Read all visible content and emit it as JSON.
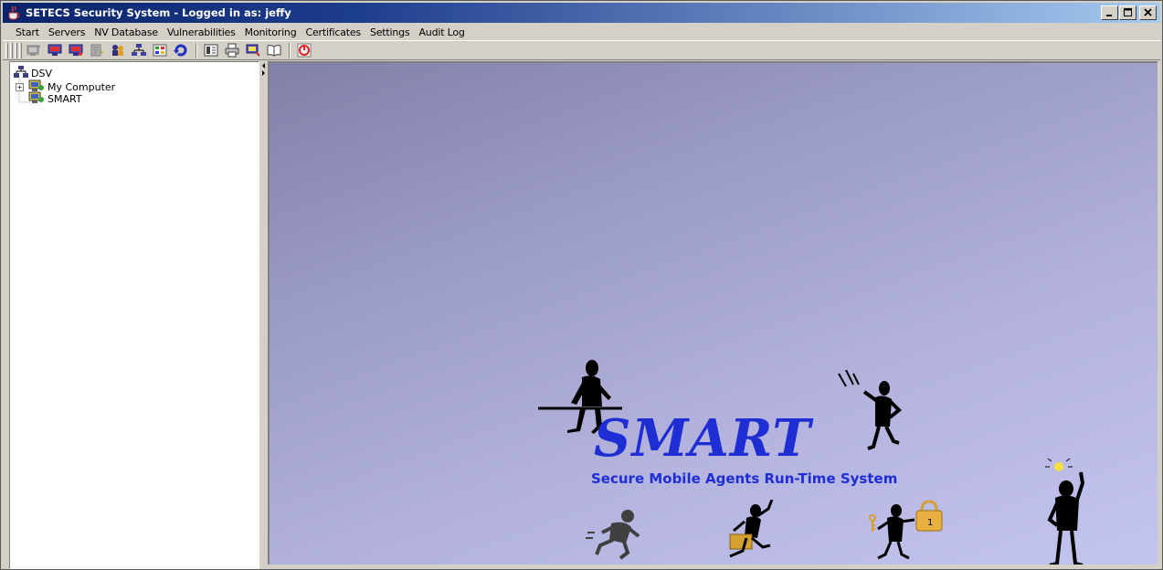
{
  "window": {
    "title": "SETECS Security System - Logged in as: jeffy",
    "controls": {
      "minimize": "_",
      "maximize": "□",
      "close": "×"
    }
  },
  "menu": [
    "Start",
    "Servers",
    "NV Database",
    "Vulnerabilities",
    "Monitoring",
    "Certificates",
    "Settings",
    "Audit Log"
  ],
  "toolbar": {
    "icons": [
      "connect-icon",
      "monitor-icon",
      "monitor-alert-icon",
      "report-icon",
      "agents-icon",
      "network-icon",
      "database-icon",
      "refresh-icon",
      "properties-icon",
      "print-icon",
      "help-icon",
      "book-icon",
      "stop-icon"
    ]
  },
  "tree": {
    "root": "DSV",
    "children": [
      {
        "label": "My Computer",
        "expandable": true,
        "expander": "+"
      },
      {
        "label": "SMART",
        "expandable": false
      }
    ]
  },
  "splash": {
    "title": "SMART",
    "subtitle": "Secure Mobile Agents Run-Time System"
  },
  "colors": {
    "title_bar": "#0a246a",
    "splash_text": "#1e2ed2",
    "splash_bg_top": "#8080a8",
    "splash_bg_bottom": "#c4c4f0"
  }
}
